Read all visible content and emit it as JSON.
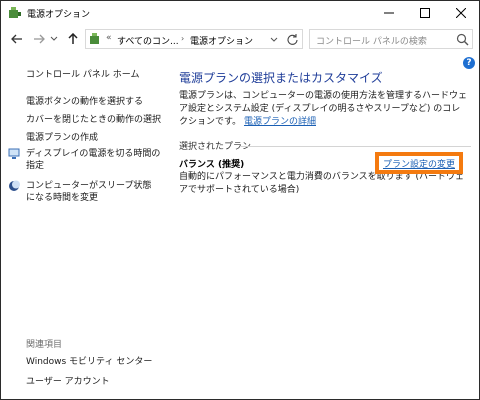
{
  "window": {
    "title": "電源オプション",
    "controls": {
      "minimize": "minimize",
      "maximize": "maximize",
      "close": "close"
    }
  },
  "nav": {
    "crumbs": [
      "すべてのコン...",
      "電源オプション"
    ],
    "search_placeholder": "コントロール パネルの検索"
  },
  "sidebar": {
    "home": "コントロール パネル ホーム",
    "links": [
      "電源ボタンの動作を選択する",
      "カバーを閉じたときの動作の選択",
      "電源プランの作成",
      "ディスプレイの電源を切る時間の指定",
      "コンピューターがスリープ状態になる時間を変更"
    ],
    "related_heading": "関連項目",
    "related": [
      "Windows モビリティ センター",
      "ユーザー アカウント"
    ]
  },
  "main": {
    "title": "電源プランの選択またはカスタマイズ",
    "description": "電源プランは、コンピューターの電源の使用方法を管理するハードウェア設定とシステム設定 (ディスプレイの明るさやスリープなど) のコレクションです。",
    "details_link": "電源プランの詳細",
    "selected_plans_label": "選択されたプラン",
    "plan": {
      "name": "バランス (推奨)",
      "change_link": "プラン設定の変更",
      "description": "自動的にパフォーマンスと電力消費のバランスを取ります (ハードウェアでサポートされている場合)"
    }
  },
  "colors": {
    "link": "#1a5fb4",
    "title_blue": "#1f3d99",
    "highlight": "#f47a0f"
  }
}
